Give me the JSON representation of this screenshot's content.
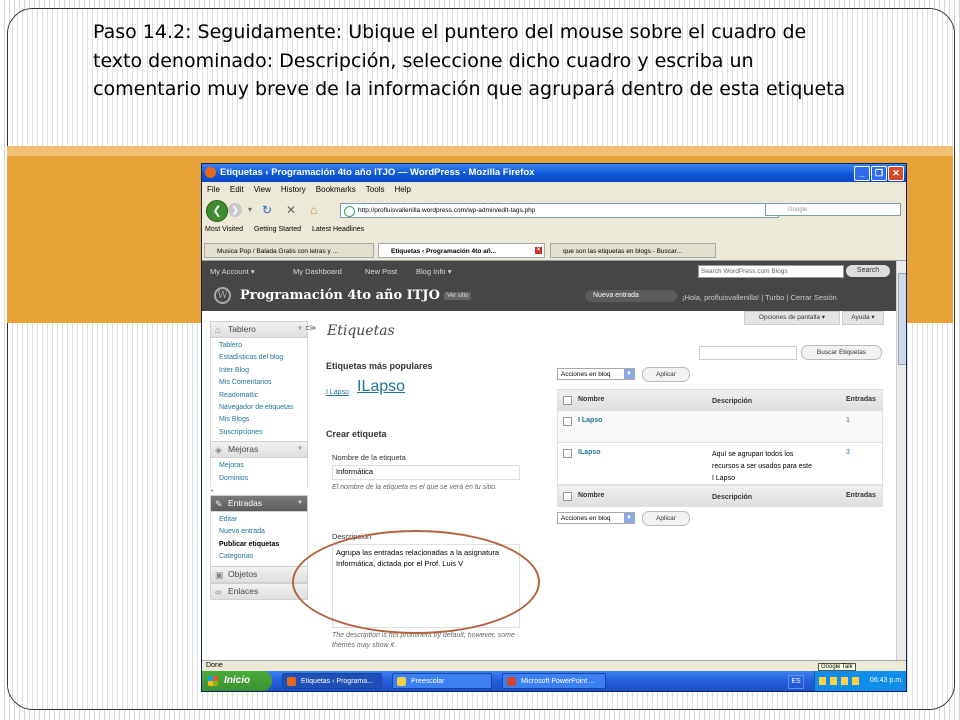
{
  "slide": {
    "instruction": "Paso 14.2: Seguidamente: Ubique el puntero del mouse sobre el cuadro de texto denominado: Descripción, seleccione dicho cuadro y escriba un comentario muy breve de la información que agrupará dentro de esta etiqueta"
  },
  "browser": {
    "window_title": "Etiquetas ‹ Programación 4to año ITJO — WordPress - Mozilla Firefox",
    "menu": [
      "File",
      "Edit",
      "View",
      "History",
      "Bookmarks",
      "Tools",
      "Help"
    ],
    "url": "http://profluisvallenilla.wordpress.com/wp-admin/edit-tags.php",
    "search_placeholder": "Google",
    "bookmarks": [
      "Most Visited",
      "Getting Started",
      "Latest Headlines"
    ],
    "tabs": [
      {
        "label": "Musica Pop / Balada Gratis con letras y ..."
      },
      {
        "label": "Etiquetas ‹ Programación 4to añ..."
      },
      {
        "label": "que son las etiquetas en blogs - Buscar..."
      }
    ],
    "status": "Done",
    "tooltip": "Google Talk"
  },
  "wp_adminbar": {
    "items": [
      "My Account ▾",
      "My Dashboard",
      "New Post",
      "Blog Info ▾"
    ],
    "search_placeholder": "Search WordPress.com Blogs",
    "search_button": "Search"
  },
  "site_header": {
    "site_name": "Programación 4to año ITJO",
    "view_site": "Ver sitio",
    "new_entry": "Nueva entrada",
    "greeting": "¡Hola, profluisvallenilla! | Turbo | Cerrar Sesión"
  },
  "top_buttons": {
    "screen_options": "Opciones de pantalla ▾",
    "help": "Ayuda ▾"
  },
  "sidebar": {
    "tablero": {
      "title": "Tablero",
      "items": [
        "Tablero",
        "Estadísticas del blog",
        "Inter Blog",
        "Mis Comentarios",
        "Readomattic",
        "Navegador de etiquetas",
        "Mis Blogs",
        "Suscripciones"
      ]
    },
    "mejoras": {
      "title": "Mejoras",
      "items": [
        "Mejoras",
        "Dominios"
      ]
    },
    "entradas": {
      "title": "Entradas",
      "items": [
        "Editar",
        "Nueva entrada",
        "Publicar etiquetas",
        "Categorías"
      ]
    },
    "objetos": {
      "title": "Objetos"
    },
    "enlaces": {
      "title": "Enlaces"
    }
  },
  "main": {
    "page_title": "Etiquetas",
    "popular_heading": "Etiquetas más populares",
    "popular_tags": [
      "I Lapso",
      "ILapso"
    ],
    "create_heading": "Crear etiqueta",
    "name_label": "Nombre de la etiqueta",
    "name_value": "Informática",
    "name_help": "El nombre de la etiqueta es el que se verá en tu sitio.",
    "desc_label": "Descripción",
    "desc_value": "Agrupa las entradas relacionadas a la asignatura Informática, dictada por el Prof. Luis V",
    "desc_help": "The description is not prominent by default; however, some themes may show it.",
    "search_button": "Buscar Etiquetas",
    "bulk_action": "Acciones en bloq",
    "apply_button": "Aplicar",
    "table": {
      "headers": [
        "Nombre",
        "Descripción",
        "Entradas"
      ],
      "rows": [
        {
          "name": "I Lapso",
          "description": "",
          "count": "1"
        },
        {
          "name": "ILapso",
          "description": "Aquí se agrupan todos los recursos a ser usados para este I Lapso",
          "count": "3"
        }
      ]
    }
  },
  "taskbar": {
    "start": "Inicio",
    "tasks": [
      "Etiquetas ‹ Programa...",
      "Preescolar",
      "Microsoft PowerPoint ..."
    ],
    "lang": "ES",
    "clock": "06:43 p.m.",
    "colors": {
      "start": "#3b9030",
      "bar": "#245edb"
    }
  },
  "colors": {
    "accent_band": "#e8a338",
    "annotation_ellipse": "#b5633f",
    "wp_link": "#21759b"
  }
}
